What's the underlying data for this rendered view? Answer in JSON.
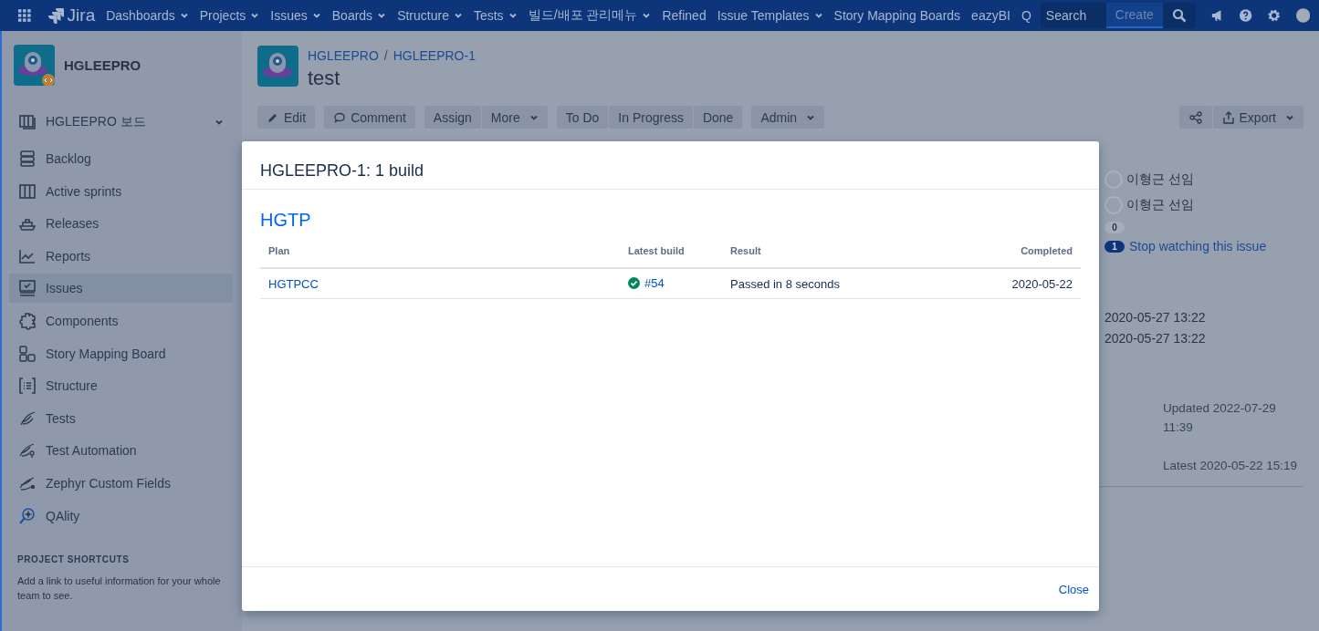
{
  "nav": {
    "logo_text": "Jira",
    "items": [
      {
        "label": "Dashboards",
        "dropdown": true
      },
      {
        "label": "Projects",
        "dropdown": true
      },
      {
        "label": "Issues",
        "dropdown": true
      },
      {
        "label": "Boards",
        "dropdown": true
      },
      {
        "label": "Structure",
        "dropdown": true
      },
      {
        "label": "Tests",
        "dropdown": true
      },
      {
        "label": "빌드/배포 관리메뉴",
        "dropdown": true
      },
      {
        "label": "Refined",
        "dropdown": false
      },
      {
        "label": "Issue Templates",
        "dropdown": true
      },
      {
        "label": "Story Mapping Boards",
        "dropdown": false
      },
      {
        "label": "eazyBI",
        "dropdown": false
      },
      {
        "label": "Q",
        "dropdown": false
      }
    ],
    "search": {
      "placeholder": "Search"
    },
    "create": "Create"
  },
  "sidebar": {
    "project": "HGLEEPRO",
    "board": "HGLEEPRO 보드",
    "items": [
      {
        "label": "Backlog",
        "kind": "backlog",
        "selected": false
      },
      {
        "label": "Active sprints",
        "kind": "sprints",
        "selected": false
      },
      {
        "label": "Releases",
        "kind": "releases",
        "selected": false
      },
      {
        "label": "Reports",
        "kind": "reports",
        "selected": false
      },
      {
        "label": "Issues",
        "kind": "issues",
        "selected": true
      },
      {
        "label": "Components",
        "kind": "components",
        "selected": false
      },
      {
        "label": "Story Mapping Board",
        "kind": "storymap",
        "selected": false
      },
      {
        "label": "Structure",
        "kind": "structure",
        "selected": false
      },
      {
        "label": "Tests",
        "kind": "tests",
        "selected": false
      },
      {
        "label": "Test Automation",
        "kind": "automation",
        "selected": false
      },
      {
        "label": "Zephyr Custom Fields",
        "kind": "zephyr",
        "selected": false
      },
      {
        "label": "QAlity",
        "kind": "qality",
        "selected": false
      }
    ],
    "shortcuts_heading": "PROJECT SHORTCUTS",
    "shortcuts_text": "Add a link to useful information for your whole team to see."
  },
  "issue": {
    "breadcrumbs": [
      "HGLEEPRO",
      "HGLEEPRO-1"
    ],
    "breadcrumb_separator": "/",
    "title": "test",
    "toolbar": [
      [
        {
          "label": "Edit",
          "kind": "edit",
          "dropdown": false
        }
      ],
      [
        {
          "label": "Comment",
          "kind": "comment",
          "dropdown": false
        }
      ],
      [
        {
          "label": "Assign",
          "kind": "plain",
          "dropdown": false
        },
        {
          "label": "More",
          "kind": "plain",
          "dropdown": true
        }
      ],
      [
        {
          "label": "To Do",
          "kind": "plain",
          "dropdown": false
        },
        {
          "label": "In Progress",
          "kind": "plain",
          "dropdown": false
        },
        {
          "label": "Done",
          "kind": "plain",
          "dropdown": false
        }
      ],
      [
        {
          "label": "Admin",
          "kind": "plain",
          "dropdown": true
        }
      ]
    ],
    "export": "Export",
    "people": [
      "이형근 선임",
      "이형근 선임"
    ],
    "votes": "0",
    "watchers": "1",
    "watch_link": "Stop watching this issue",
    "dates": [
      "2020-05-27 13:22",
      "2020-05-27 13:22"
    ],
    "updated": "Updated 2022-07-29 11:39",
    "latest": "Latest 2020-05-22 15:19"
  },
  "dialog": {
    "title": "HGLEEPRO-1: 1 build",
    "group": "HGTP",
    "columns": [
      "Plan",
      "Latest build",
      "Result",
      "Completed"
    ],
    "rows": [
      {
        "plan": "HGTPCC",
        "build": "#54",
        "passed": true,
        "result": "Passed in 8 seconds",
        "completed": "2020-05-22"
      }
    ],
    "close": "Close"
  }
}
